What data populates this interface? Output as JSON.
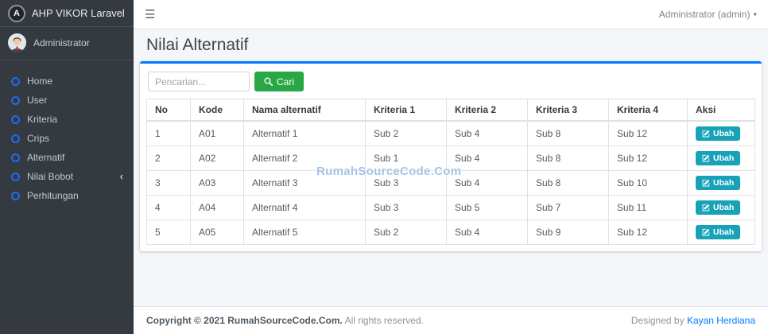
{
  "sidebar": {
    "brand": "AHP VIKOR Laravel",
    "user": "Administrator",
    "items": [
      {
        "label": "Home"
      },
      {
        "label": "User"
      },
      {
        "label": "Kriteria"
      },
      {
        "label": "Crips"
      },
      {
        "label": "Alternatif"
      },
      {
        "label": "Nilai Bobot",
        "has_submenu": true
      },
      {
        "label": "Perhitungan"
      }
    ]
  },
  "navbar": {
    "user_menu_label": "Administrator (admin)"
  },
  "page": {
    "title": "Nilai Alternatif"
  },
  "search": {
    "placeholder": "Pencarian...",
    "button_label": "Cari"
  },
  "table": {
    "headers": [
      "No",
      "Kode",
      "Nama alternatif",
      "Kriteria 1",
      "Kriteria 2",
      "Kriteria 3",
      "Kriteria 4",
      "Aksi"
    ],
    "action_label": "Ubah",
    "rows": [
      {
        "no": "1",
        "kode": "A01",
        "nama": "Alternatif 1",
        "k1": "Sub 2",
        "k2": "Sub 4",
        "k3": "Sub 8",
        "k4": "Sub 12"
      },
      {
        "no": "2",
        "kode": "A02",
        "nama": "Alternatif 2",
        "k1": "Sub 1",
        "k2": "Sub 4",
        "k3": "Sub 8",
        "k4": "Sub 12"
      },
      {
        "no": "3",
        "kode": "A03",
        "nama": "Alternatif 3",
        "k1": "Sub 3",
        "k2": "Sub 4",
        "k3": "Sub 8",
        "k4": "Sub 10"
      },
      {
        "no": "4",
        "kode": "A04",
        "nama": "Alternatif 4",
        "k1": "Sub 3",
        "k2": "Sub 5",
        "k3": "Sub 7",
        "k4": "Sub 11"
      },
      {
        "no": "5",
        "kode": "A05",
        "nama": "Alternatif 5",
        "k1": "Sub 2",
        "k2": "Sub 4",
        "k3": "Sub 9",
        "k4": "Sub 12"
      }
    ]
  },
  "watermark": "RumahSourceCode.Com",
  "footer": {
    "copyright_bold": "Copyright © 2021 RumahSourceCode.Com.",
    "copyright_rest": "All rights reserved.",
    "designed_by": "Designed by",
    "designer": "Kayan Herdiana"
  },
  "icons": {
    "app_logo": "A",
    "hamburger": "☰",
    "caret_down": "▾",
    "chevron_left": "‹",
    "menu_bullet": "circle-outline",
    "search": "magnifier",
    "edit": "pencil-square"
  },
  "colors": {
    "sidebar_bg": "#343a40",
    "accent_blue": "#007bff",
    "menu_icon_blue": "#1b6ef3",
    "button_green": "#28a745",
    "button_teal": "#17a2b8",
    "content_bg": "#f4f6f9",
    "link_blue": "#007bff",
    "watermark_blue": "#8fb6e0"
  }
}
